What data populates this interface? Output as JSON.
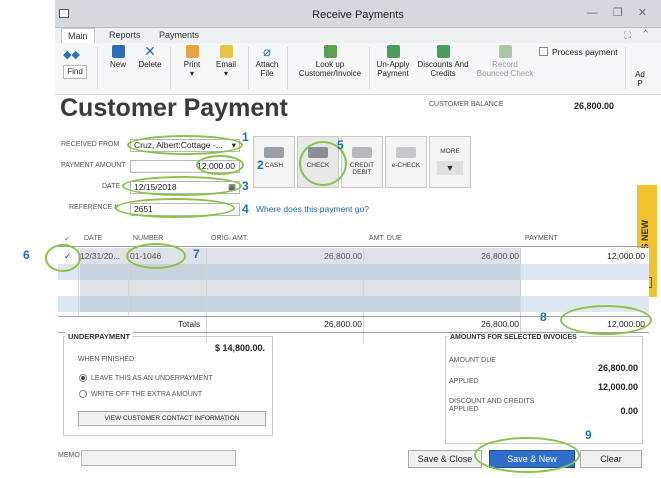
{
  "window": {
    "title": "Receive Payments",
    "controls": "— ❐ ✕"
  },
  "tabs": [
    "Main",
    "Reports",
    "Payments"
  ],
  "tabbar_icons": "⛶ ⌃",
  "ribbon": {
    "find": "Find",
    "new": "New",
    "delete": "Delete",
    "print": "Print",
    "email": "Email",
    "attach": "Attach\nFile",
    "lookup": "Look up\nCustomer/Invoice",
    "unapply": "Un-Apply\nPayment",
    "discounts": "Discounts And\nCredits",
    "record": "Record\nBounced Check",
    "process": "Process payment",
    "add_partial": "Ad\nP"
  },
  "page_title": "Customer Payment",
  "balance": {
    "label": "CUSTOMER BALANCE",
    "value": "26,800.00"
  },
  "form": {
    "received_from_label": "RECEIVED FROM",
    "received_from": "Cruz, Albert:Cottage -...",
    "amount_label": "PAYMENT AMOUNT",
    "amount": "12,000.00",
    "date_label": "DATE",
    "date": "12/15/2018",
    "ref_label": "REFERENCE #",
    "ref": "2651",
    "where_link": "Where does this payment go?"
  },
  "methods": [
    "CASH",
    "CHECK",
    "CREDIT\nDEBIT",
    "e-CHECK",
    "MORE"
  ],
  "annotations": [
    "1",
    "2",
    "3",
    "4",
    "5",
    "6",
    "7",
    "8",
    "9"
  ],
  "grid": {
    "headers": [
      "✓",
      "DATE",
      "NUMBER",
      "ORIG. AMT.",
      "AMT. DUE",
      "PAYMENT"
    ],
    "row": {
      "check": "✓",
      "date": "12/31/20...",
      "number": "01-1046",
      "orig": "26,800.00",
      "due": "26,800.00",
      "payment": "12,000.00"
    },
    "totals": {
      "label": "Totals",
      "orig": "26,800.00",
      "due": "26,800.00",
      "payment": "12,000.00"
    }
  },
  "whats_new": "WHAT'S NEW",
  "underpayment": {
    "title": "UNDERPAYMENT",
    "amount": "$ 14,800.00.",
    "when": "WHEN FINISHED:",
    "opt1": "LEAVE THIS AS AN UNDERPAYMENT",
    "opt2": "WRITE OFF THE EXTRA AMOUNT",
    "contact_btn": "VIEW CUSTOMER CONTACT INFORMATION"
  },
  "amounts": {
    "title": "AMOUNTS FOR SELECTED INVOICES",
    "due_label": "AMOUNT DUE",
    "due": "26,800.00",
    "applied_label": "APPLIED",
    "applied": "12,000.00",
    "disc_label": "DISCOUNT AND CREDITS\nAPPLIED",
    "disc": "0.00"
  },
  "memo_label": "MEMO",
  "buttons": {
    "save_close": "Save & Close",
    "save_new": "Save & New",
    "clear": "Clear"
  }
}
